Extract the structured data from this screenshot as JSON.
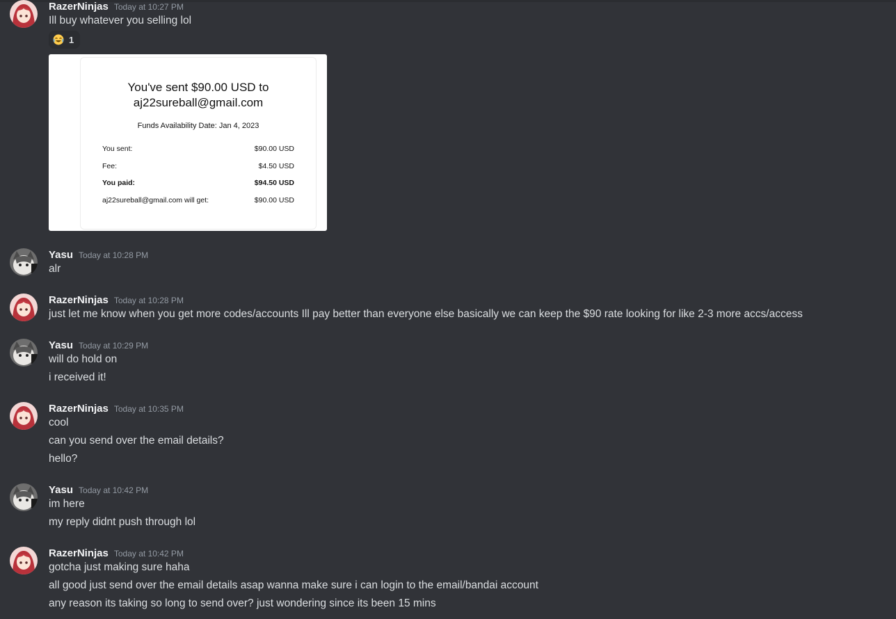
{
  "messages": [
    {
      "author": "RazerNinjas",
      "timestamp": "Today at 10:27 PM",
      "lines": [
        "Ill buy whatever you selling lol"
      ],
      "reaction": {
        "emoji": "joy-emoji",
        "count": "1"
      },
      "attachment": {
        "title_line1": "You've sent $90.00 USD to",
        "title_line2": "aj22sureball@gmail.com",
        "availability": "Funds Availability Date: Jan 4, 2023",
        "rows": [
          {
            "label": "You sent:",
            "value": "$90.00 USD",
            "bold": false
          },
          {
            "label": "Fee:",
            "value": "$4.50 USD",
            "bold": false
          },
          {
            "label": "You paid:",
            "value": "$94.50 USD",
            "bold": true
          },
          {
            "label": "aj22sureball@gmail.com will get:",
            "value": "$90.00 USD",
            "bold": false
          }
        ]
      }
    },
    {
      "author": "Yasu",
      "timestamp": "Today at 10:28 PM",
      "lines": [
        "alr"
      ]
    },
    {
      "author": "RazerNinjas",
      "timestamp": "Today at 10:28 PM",
      "lines": [
        "just let me know when you get more codes/accounts Ill pay better than everyone else basically we can keep the $90 rate looking for like 2-3 more accs/access"
      ]
    },
    {
      "author": "Yasu",
      "timestamp": "Today at 10:29 PM",
      "lines": [
        "will do hold on",
        "i received it!"
      ]
    },
    {
      "author": "RazerNinjas",
      "timestamp": "Today at 10:35 PM",
      "lines": [
        "cool",
        "can you send over the email details?",
        "hello?"
      ]
    },
    {
      "author": "Yasu",
      "timestamp": "Today at 10:42 PM",
      "lines": [
        "im here",
        "my reply didnt push through lol"
      ]
    },
    {
      "author": "RazerNinjas",
      "timestamp": "Today at 10:42 PM",
      "lines": [
        "gotcha just making sure haha",
        "all good just send over the email details asap wanna make sure i can login to the email/bandai account",
        "any reason its taking so long to send over? just wondering since its been 15 mins"
      ]
    }
  ],
  "colors": {
    "background": "#313338",
    "username": "#f2f3f5",
    "timestamp": "#949ba4",
    "text": "#dbdee1"
  }
}
